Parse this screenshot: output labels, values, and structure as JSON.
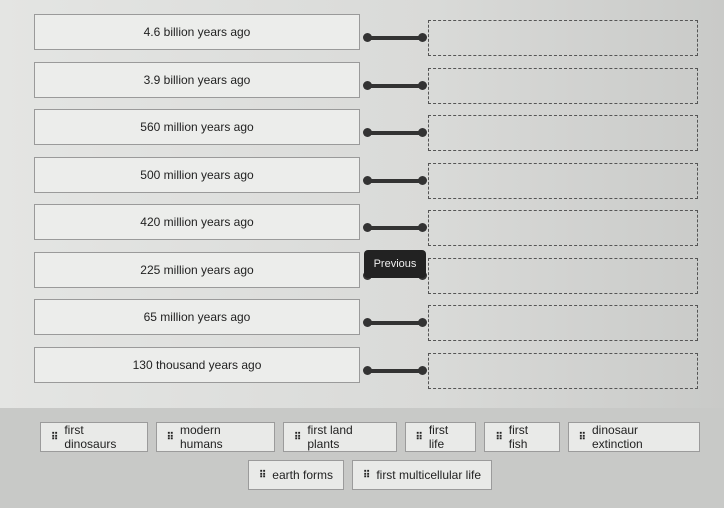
{
  "rows": [
    {
      "date": "4.6 billion years ago"
    },
    {
      "date": "3.9 billion years ago"
    },
    {
      "date": "560 million years ago"
    },
    {
      "date": "500 million years ago"
    },
    {
      "date": "420 million years ago"
    },
    {
      "date": "225 million years ago"
    },
    {
      "date": "65 million years ago"
    },
    {
      "date": "130 thousand years ago"
    }
  ],
  "tooltip": "Previous",
  "grip_icon": "drag-handle-icon",
  "chips_row1": [
    "first dinosaurs",
    "modern humans",
    "first land plants",
    "first life",
    "first fish",
    "dinosaur extinction"
  ],
  "chips_row2": [
    "earth forms",
    "first multicellular life"
  ]
}
